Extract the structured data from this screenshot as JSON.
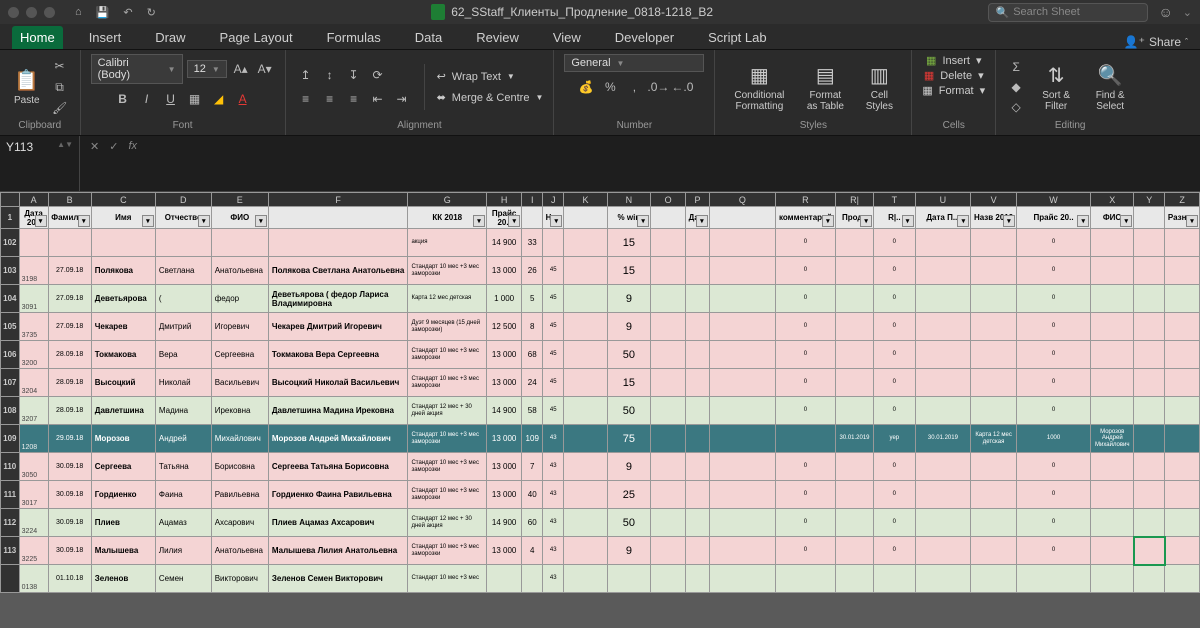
{
  "titlebar": {
    "filename": "62_SStaff_Клиенты_Продление_0818-1218_B2",
    "search_placeholder": "Search Sheet"
  },
  "tabs": [
    "Home",
    "Insert",
    "Draw",
    "Page Layout",
    "Formulas",
    "Data",
    "Review",
    "View",
    "Developer",
    "Script Lab"
  ],
  "share": "Share",
  "ribbon": {
    "paste": "Paste",
    "clipboard": "Clipboard",
    "font_name": "Calibri (Body)",
    "font_size": "12",
    "font": "Font",
    "alignment": "Alignment",
    "wrap": "Wrap Text",
    "merge": "Merge & Centre",
    "number_format": "General",
    "number": "Number",
    "cond": "Conditional Formatting",
    "fmt_table": "Format as Table",
    "cell_styles": "Cell Styles",
    "styles": "Styles",
    "insert": "Insert",
    "delete": "Delete",
    "format": "Format",
    "cells": "Cells",
    "sort": "Sort & Filter",
    "find": "Find & Select",
    "editing": "Editing"
  },
  "namebox": "Y113",
  "col_letters": [
    "",
    "A",
    "B",
    "C",
    "D",
    "E",
    "F",
    "G",
    "H",
    "I",
    "J",
    "K",
    "N",
    "O",
    "P",
    "Q",
    "R",
    "R|",
    "T",
    "U",
    "V",
    "W",
    "X",
    "Y",
    "Z"
  ],
  "headers": [
    "",
    "Дата 20..",
    "Фамилия",
    "Имя",
    "Отчество",
    "ФИО",
    "",
    "КК 2018",
    "Прайс 20..",
    "",
    "Нед",
    "",
    "% win",
    "",
    "Дат..",
    "",
    "комментарий",
    "Прод..",
    "R|..",
    "Дата П...",
    "Назв 2019",
    "Прайс 20..",
    "ФИО",
    "",
    "Разниц"
  ],
  "rows": [
    {
      "cls": "pink",
      "n": "102",
      "id": "",
      "date": "",
      "fam": "",
      "name": "",
      "pat": "",
      "fio": "",
      "tarif": "акция",
      "price": "14 900",
      "c1": "33",
      "c2": "",
      "pct": "15",
      "r": "0",
      "s": "",
      "t": "0",
      "u": "",
      "v": "",
      "w": "0",
      "x": ""
    },
    {
      "cls": "pink",
      "n": "103",
      "id": "3198",
      "date": "27.09.18",
      "fam": "Полякова",
      "name": "Светлана",
      "pat": "Анатольевна",
      "fio": "Полякова Светлана Анатольевна",
      "tarif": "Стандарт 10 мес +3 мес заморозки",
      "price": "13 000",
      "c1": "26",
      "c2": "45",
      "pct": "15",
      "r": "0",
      "s": "",
      "t": "0",
      "u": "",
      "v": "",
      "w": "0",
      "x": ""
    },
    {
      "cls": "green",
      "n": "104",
      "id": "3091",
      "date": "27.09.18",
      "fam": "Деветьярова",
      "name": "(",
      "pat": "федор",
      "fio": "Деветьярова ( федор  Лариса Владимировна",
      "tarif": "Карта 12 мес детская",
      "price": "1 000",
      "c1": "5",
      "c2": "45",
      "pct": "9",
      "r": "0",
      "s": "",
      "t": "0",
      "u": "",
      "v": "",
      "w": "0",
      "x": ""
    },
    {
      "cls": "pink",
      "n": "105",
      "id": "3735",
      "date": "27.09.18",
      "fam": "Чекарев",
      "name": "Дмитрий",
      "pat": "Игоревич",
      "fio": "Чекарев Дмитрий Игоревич",
      "tarif": "Дуэт 9 месяцев (15 дней заморозки)",
      "price": "12 500",
      "c1": "8",
      "c2": "45",
      "pct": "9",
      "r": "0",
      "s": "",
      "t": "0",
      "u": "",
      "v": "",
      "w": "0",
      "x": ""
    },
    {
      "cls": "pink",
      "n": "106",
      "id": "3200",
      "date": "28.09.18",
      "fam": "Токмакова",
      "name": "Вера",
      "pat": "Сергеевна",
      "fio": "Токмакова Вера Сергеевна",
      "tarif": "Стандарт 10 мес +3 мес заморозки",
      "price": "13 000",
      "c1": "68",
      "c2": "45",
      "pct": "50",
      "r": "0",
      "s": "",
      "t": "0",
      "u": "",
      "v": "",
      "w": "0",
      "x": ""
    },
    {
      "cls": "pink",
      "n": "107",
      "id": "3204",
      "date": "28.09.18",
      "fam": "Высоцкий",
      "name": "Николай",
      "pat": "Васильевич",
      "fio": "Высоцкий Николай Васильевич",
      "tarif": "Стандарт 10 мес +3 мес заморозки",
      "price": "13 000",
      "c1": "24",
      "c2": "45",
      "pct": "15",
      "r": "0",
      "s": "",
      "t": "0",
      "u": "",
      "v": "",
      "w": "0",
      "x": ""
    },
    {
      "cls": "green",
      "n": "108",
      "id": "3207",
      "date": "28.09.18",
      "fam": "Давлетшина",
      "name": "Мадина",
      "pat": "Ирековна",
      "fio": "Давлетшина Мадина Ирековна",
      "tarif": "Стандарт 12 мес + 30 дней акция",
      "price": "14 900",
      "c1": "58",
      "c2": "45",
      "pct": "50",
      "r": "0",
      "s": "",
      "t": "0",
      "u": "",
      "v": "",
      "w": "0",
      "x": ""
    },
    {
      "cls": "teal",
      "n": "109",
      "id": "1208",
      "date": "29.09.18",
      "fam": "Морозов",
      "name": "Андрей",
      "pat": "Михайлович",
      "fio": "Морозов Андрей Михайлович",
      "tarif": "Стандарт 10 мес +3 мес заморозки",
      "price": "13 000",
      "c1": "109",
      "c2": "43",
      "pct": "75",
      "r": "",
      "s": "30.01.2019",
      "t": "yep",
      "u": "30.01.2019",
      "v": "Карта 12 мес детская",
      "w": "1000",
      "x": "Морозов Андрей Михайлович"
    },
    {
      "cls": "pink",
      "n": "110",
      "id": "3050",
      "date": "30.09.18",
      "fam": "Сергеева",
      "name": "Татьяна",
      "pat": "Борисовна",
      "fio": "Сергеева Татьяна Борисовна",
      "tarif": "Стандарт 10 мес +3 мес заморозки",
      "price": "13 000",
      "c1": "7",
      "c2": "43",
      "pct": "9",
      "r": "0",
      "s": "",
      "t": "0",
      "u": "",
      "v": "",
      "w": "0",
      "x": ""
    },
    {
      "cls": "pink",
      "n": "111",
      "id": "3017",
      "date": "30.09.18",
      "fam": "Гордиенко",
      "name": "Фаина",
      "pat": "Равильевна",
      "fio": "Гордиенко Фаина Равильевна",
      "tarif": "Стандарт 10 мес +3 мес заморозки",
      "price": "13 000",
      "c1": "40",
      "c2": "43",
      "pct": "25",
      "r": "0",
      "s": "",
      "t": "0",
      "u": "",
      "v": "",
      "w": "0",
      "x": ""
    },
    {
      "cls": "green",
      "n": "112",
      "id": "3224",
      "date": "30.09.18",
      "fam": "Плиев",
      "name": "Ацамаз",
      "pat": "Ахсарович",
      "fio": "Плиев Ацамаз Ахсарович",
      "tarif": "Стандарт 12 мес + 30 дней акция",
      "price": "14 900",
      "c1": "60",
      "c2": "43",
      "pct": "50",
      "r": "0",
      "s": "",
      "t": "0",
      "u": "",
      "v": "",
      "w": "0",
      "x": ""
    },
    {
      "cls": "pink",
      "n": "113",
      "id": "3225",
      "date": "30.09.18",
      "fam": "Малышева",
      "name": "Лилия",
      "pat": "Анатольевна",
      "fio": "Малышева Лилия Анатольевна",
      "tarif": "Стандарт 10 мес +3 мес заморозки",
      "price": "13 000",
      "c1": "4",
      "c2": "43",
      "pct": "9",
      "r": "0",
      "s": "",
      "t": "0",
      "u": "",
      "v": "",
      "w": "0",
      "x": "",
      "sel": true
    },
    {
      "cls": "green",
      "n": "",
      "id": "0138",
      "date": "01.10.18",
      "fam": "Зеленов",
      "name": "Семен",
      "pat": "Викторович",
      "fio": "Зеленов Семен Викторович",
      "tarif": "Стандарт 10 мес +3 мес",
      "price": "",
      "c1": "",
      "c2": "43",
      "pct": "",
      "r": "",
      "s": "",
      "t": "",
      "u": "",
      "v": "",
      "w": "",
      "x": ""
    }
  ]
}
